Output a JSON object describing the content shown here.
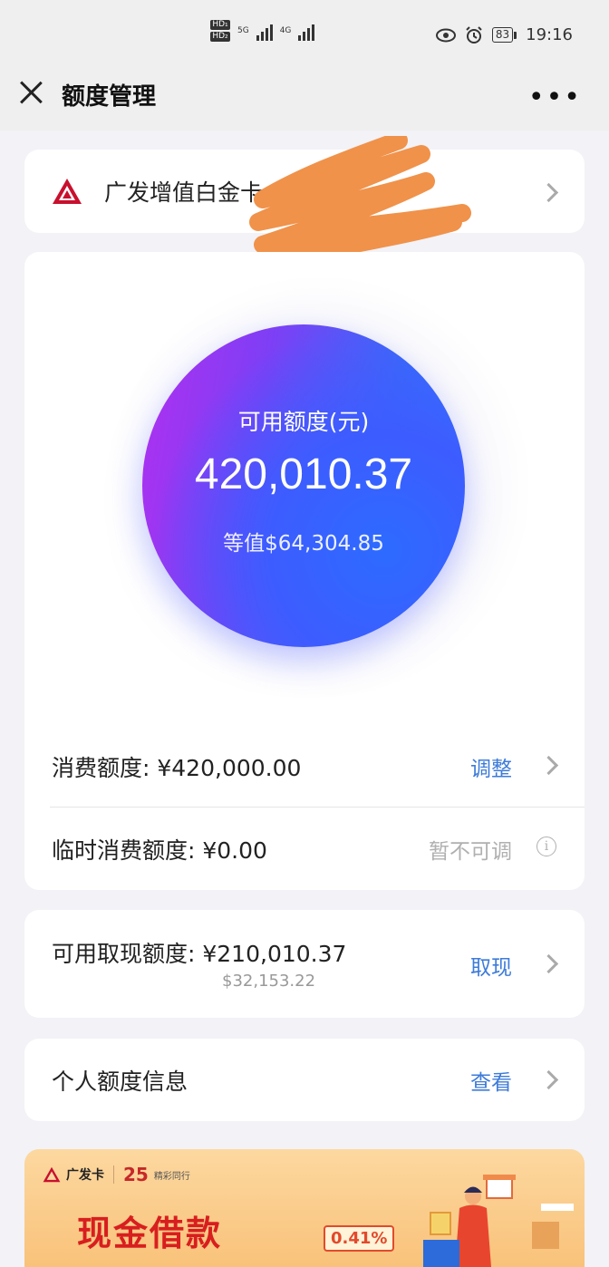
{
  "status_bar": {
    "hd1": "HD₁",
    "hd2": "HD₂",
    "net1": "5G",
    "net2": "4G",
    "battery": "83",
    "time": "19:16"
  },
  "header": {
    "title": "额度管理"
  },
  "card": {
    "name": "广发增值白金卡"
  },
  "limits": {
    "available_label": "可用额度(元)",
    "available_value": "420,010.37",
    "available_usd": "等值$64,304.85",
    "consumption_label": "消费额度: ¥420,000.00",
    "consumption_action": "调整",
    "temp_label": "临时消费额度: ¥0.00",
    "temp_action": "暂不可调",
    "info_glyph": "i"
  },
  "cash": {
    "label": "可用取现额度: ¥210,010.37",
    "usd": "$32,153.22",
    "action": "取现"
  },
  "personal": {
    "label": "个人额度信息",
    "action": "查看"
  },
  "banner": {
    "brand": "广发卡",
    "anniversary": "25",
    "tagline": "精彩同行",
    "title": "现金借款",
    "rate": "0.41%"
  },
  "colors": {
    "accent": "#3d7bd9",
    "circle_start": "#b030f0",
    "circle_end": "#2a7cff",
    "banner_red": "#d81e1e"
  }
}
